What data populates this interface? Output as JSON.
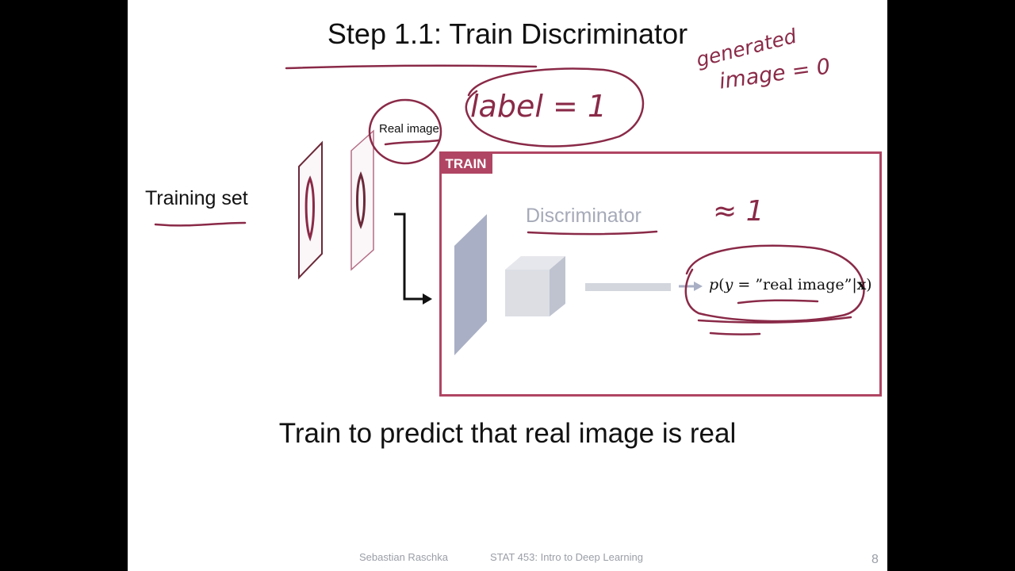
{
  "slide": {
    "title": "Step 1.1: Train Discriminator",
    "training_set_label": "Training set",
    "real_image_label": "Real image",
    "train_tag": "TRAIN",
    "discriminator_label": "Discriminator",
    "probability": {
      "p": "p",
      "open": "(",
      "y": "y",
      "equals": " = ”real image”|",
      "x": "x",
      "close": ")"
    },
    "caption": "Train to predict that real image is real",
    "footer": {
      "author": "Sebastian Raschka",
      "course": "STAT 453: Intro to Deep Learning",
      "page_number": "8"
    }
  },
  "annotations": {
    "generated": "generated",
    "image_eq_0": "image = 0",
    "label_eq_1": "label = 1",
    "approx_1": "≈ 1"
  },
  "colors": {
    "accent": "#b04563",
    "annotation_ink": "#8a2a48",
    "layer_blue": "#a9afc4",
    "footer_gray": "#9a9ea6"
  }
}
